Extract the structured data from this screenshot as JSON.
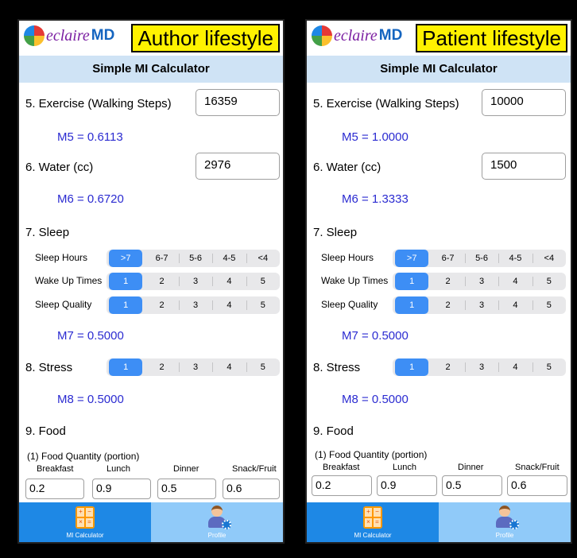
{
  "panels": [
    {
      "logo": {
        "brand": "eclaire",
        "suffix": "MD"
      },
      "banner": "Author lifestyle",
      "title": "Simple MI Calculator",
      "exercise": {
        "label": "5. Exercise (Walking Steps)",
        "value": "16359",
        "result": "M5 = 0.6113"
      },
      "water": {
        "label": "6. Water (cc)",
        "value": "2976",
        "result": "M6 = 0.6720"
      },
      "sleep": {
        "heading": "7. Sleep",
        "hours_label": "Sleep Hours",
        "wake_label": "Wake Up Times",
        "quality_label": "Sleep Quality",
        "result": "M7 = 0.5000"
      },
      "stress": {
        "label": "8. Stress",
        "result": "M8 = 0.5000"
      },
      "food": {
        "heading": "9. Food",
        "subheading": "(1) Food Quantity (portion)",
        "cols": [
          "Breakfast",
          "Lunch",
          "Dinner",
          "Snack/Fruit"
        ],
        "values": [
          "0.2",
          "0.9",
          "0.5",
          "0.6"
        ]
      },
      "tabs": {
        "calculator": "MI Calculator",
        "profile": "Profile"
      }
    },
    {
      "logo": {
        "brand": "eclaire",
        "suffix": "MD"
      },
      "banner": "Patient lifestyle",
      "title": "Simple MI Calculator",
      "exercise": {
        "label": "5. Exercise (Walking Steps)",
        "value": "10000",
        "result": "M5 = 1.0000"
      },
      "water": {
        "label": "6. Water (cc)",
        "value": "1500",
        "result": "M6 = 1.3333"
      },
      "sleep": {
        "heading": "7. Sleep",
        "hours_label": "Sleep Hours",
        "wake_label": "Wake Up Times",
        "quality_label": "Sleep Quality",
        "result": "M7 = 0.5000"
      },
      "stress": {
        "label": "8. Stress",
        "result": "M8 = 0.5000"
      },
      "food": {
        "heading": "9. Food",
        "subheading": "(1) Food Quantity (portion)",
        "cols": [
          "Breakfast",
          "Lunch",
          "Dinner",
          "Snack/Fruit"
        ],
        "values": [
          "0.2",
          "0.9",
          "0.5",
          "0.6"
        ]
      },
      "tabs": {
        "calculator": "MI Calculator",
        "profile": "Profile"
      }
    }
  ],
  "segments": {
    "hours": [
      "&gt;7",
      "6-7",
      "5-6",
      "4-5",
      "<4"
    ],
    "hours_text": [
      ">7",
      "6-7",
      "5-6",
      "4-5",
      "<4"
    ],
    "levels": [
      "1",
      "2",
      "3",
      "4",
      "5"
    ]
  },
  "selected": {
    "hours": 0,
    "wake": 0,
    "quality": 0,
    "stress": 0
  },
  "colors": {
    "accent": "#3d8ef5",
    "result": "#2b2bd1",
    "titlebar": "#cfe3f5",
    "banner": "#fff200",
    "tabbar": "#2196f3"
  },
  "icons": {
    "calculator_tab": "calculator-icon",
    "profile_tab": "profile-icon"
  }
}
